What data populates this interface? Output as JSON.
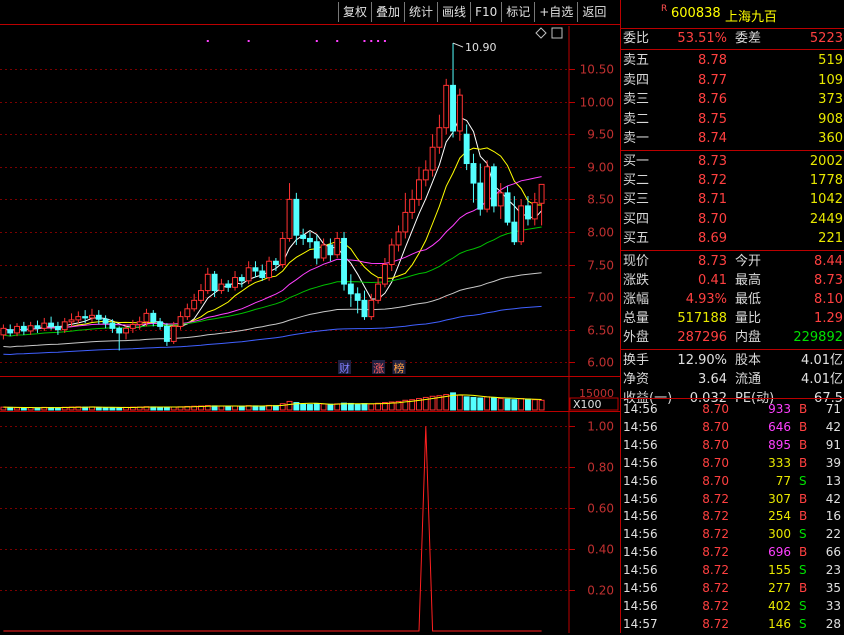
{
  "toolbar": [
    "复权",
    "叠加",
    "统计",
    "画线",
    "F10",
    "标记",
    "+自选",
    "返回"
  ],
  "stock": {
    "r_mark": "R",
    "code": "600838",
    "name": "上海九百"
  },
  "quote": {
    "wei_bi_label": "委比",
    "wei_bi": "53.51%",
    "wei_cha_label": "委差",
    "wei_cha": "5223",
    "asks": [
      {
        "label": "卖五",
        "price": "8.78",
        "vol": "519"
      },
      {
        "label": "卖四",
        "price": "8.77",
        "vol": "109"
      },
      {
        "label": "卖三",
        "price": "8.76",
        "vol": "373"
      },
      {
        "label": "卖二",
        "price": "8.75",
        "vol": "908"
      },
      {
        "label": "卖一",
        "price": "8.74",
        "vol": "360"
      }
    ],
    "bids": [
      {
        "label": "买一",
        "price": "8.73",
        "vol": "2002"
      },
      {
        "label": "买二",
        "price": "8.72",
        "vol": "1778"
      },
      {
        "label": "买三",
        "price": "8.71",
        "vol": "1042"
      },
      {
        "label": "买四",
        "price": "8.70",
        "vol": "2449"
      },
      {
        "label": "买五",
        "price": "8.69",
        "vol": "221"
      }
    ],
    "stats": [
      {
        "l1": "现价",
        "v1": "8.73",
        "c1": "red",
        "l2": "今开",
        "v2": "8.44",
        "c2": "red"
      },
      {
        "l1": "涨跌",
        "v1": "0.41",
        "c1": "red",
        "l2": "最高",
        "v2": "8.73",
        "c2": "red"
      },
      {
        "l1": "涨幅",
        "v1": "4.93%",
        "c1": "red",
        "l2": "最低",
        "v2": "8.10",
        "c2": "red"
      },
      {
        "l1": "总量",
        "v1": "517188",
        "c1": "yellow",
        "l2": "量比",
        "v2": "1.29",
        "c2": "red"
      },
      {
        "l1": "外盘",
        "v1": "287296",
        "c1": "red",
        "l2": "内盘",
        "v2": "229892",
        "c2": "green"
      }
    ],
    "info": [
      {
        "l1": "换手",
        "v1": "12.90%",
        "l2": "股本",
        "v2": "4.01亿"
      },
      {
        "l1": "净资",
        "v1": "3.64",
        "l2": "流通",
        "v2": "4.01亿"
      },
      {
        "l1": "收益(一)",
        "v1": "0.032",
        "l2": "PE(动)",
        "v2": "67.5"
      }
    ]
  },
  "ticks": [
    {
      "time": "14:56",
      "price": "8.70",
      "vol": "933",
      "dir": "B",
      "count": "71"
    },
    {
      "time": "14:56",
      "price": "8.70",
      "vol": "646",
      "dir": "B",
      "count": "42"
    },
    {
      "time": "14:56",
      "price": "8.70",
      "vol": "895",
      "dir": "B",
      "count": "91"
    },
    {
      "time": "14:56",
      "price": "8.70",
      "vol": "333",
      "dir": "B",
      "count": "39"
    },
    {
      "time": "14:56",
      "price": "8.70",
      "vol": "77",
      "dir": "S",
      "count": "13"
    },
    {
      "time": "14:56",
      "price": "8.72",
      "vol": "307",
      "dir": "B",
      "count": "42"
    },
    {
      "time": "14:56",
      "price": "8.72",
      "vol": "254",
      "dir": "B",
      "count": "16"
    },
    {
      "time": "14:56",
      "price": "8.72",
      "vol": "300",
      "dir": "S",
      "count": "22"
    },
    {
      "time": "14:56",
      "price": "8.72",
      "vol": "696",
      "dir": "B",
      "count": "66"
    },
    {
      "time": "14:56",
      "price": "8.72",
      "vol": "155",
      "dir": "S",
      "count": "23"
    },
    {
      "time": "14:56",
      "price": "8.72",
      "vol": "277",
      "dir": "B",
      "count": "35"
    },
    {
      "time": "14:56",
      "price": "8.72",
      "vol": "402",
      "dir": "S",
      "count": "33"
    },
    {
      "time": "14:57",
      "price": "8.72",
      "vol": "146",
      "dir": "S",
      "count": "28"
    }
  ],
  "chart_data": [
    {
      "type": "candlestick",
      "title": "",
      "ylim": [
        5.85,
        11.1
      ],
      "yticks": [
        "10.50",
        "10.00",
        "9.50",
        "9.00",
        "8.50",
        "8.00",
        "7.50",
        "7.00",
        "6.50",
        "6.00"
      ],
      "high_annotation": "10.90",
      "event_marks": [
        "财",
        "涨",
        "榜"
      ],
      "candles": [
        [
          6.42,
          6.52,
          6.35,
          6.58
        ],
        [
          6.5,
          6.45,
          6.4,
          6.58
        ],
        [
          6.45,
          6.55,
          6.4,
          6.6
        ],
        [
          6.55,
          6.48,
          6.42,
          6.62
        ],
        [
          6.48,
          6.56,
          6.42,
          6.62
        ],
        [
          6.56,
          6.52,
          6.45,
          6.64
        ],
        [
          6.52,
          6.6,
          6.48,
          6.68
        ],
        [
          6.6,
          6.55,
          6.5,
          6.7
        ],
        [
          6.55,
          6.5,
          6.42,
          6.62
        ],
        [
          6.5,
          6.62,
          6.45,
          6.68
        ],
        [
          6.62,
          6.65,
          6.55,
          6.75
        ],
        [
          6.65,
          6.7,
          6.6,
          6.78
        ],
        [
          6.7,
          6.68,
          6.6,
          6.8
        ],
        [
          6.68,
          6.72,
          6.62,
          6.82
        ],
        [
          6.72,
          6.66,
          6.58,
          6.8
        ],
        [
          6.66,
          6.6,
          6.52,
          6.72
        ],
        [
          6.6,
          6.52,
          6.45,
          6.66
        ],
        [
          6.52,
          6.45,
          6.18,
          6.55
        ],
        [
          6.45,
          6.52,
          6.35,
          6.58
        ],
        [
          6.52,
          6.58,
          6.45,
          6.65
        ],
        [
          6.58,
          6.62,
          6.5,
          6.7
        ],
        [
          6.62,
          6.75,
          6.55,
          6.82
        ],
        [
          6.75,
          6.62,
          6.55,
          6.8
        ],
        [
          6.62,
          6.55,
          6.5,
          6.68
        ],
        [
          6.55,
          6.32,
          6.25,
          6.6
        ],
        [
          6.32,
          6.55,
          6.28,
          6.62
        ],
        [
          6.55,
          6.7,
          6.5,
          6.78
        ],
        [
          6.7,
          6.82,
          6.65,
          6.9
        ],
        [
          6.82,
          6.95,
          6.78,
          7.05
        ],
        [
          6.95,
          7.1,
          6.9,
          7.2
        ],
        [
          7.1,
          7.35,
          7.05,
          7.45
        ],
        [
          7.35,
          7.1,
          7.0,
          7.4
        ],
        [
          7.1,
          7.2,
          7.05,
          7.28
        ],
        [
          7.2,
          7.15,
          7.08,
          7.26
        ],
        [
          7.15,
          7.3,
          7.1,
          7.4
        ],
        [
          7.3,
          7.25,
          7.15,
          7.35
        ],
        [
          7.25,
          7.45,
          7.2,
          7.55
        ],
        [
          7.45,
          7.4,
          7.3,
          7.55
        ],
        [
          7.4,
          7.3,
          7.25,
          7.5
        ],
        [
          7.3,
          7.55,
          7.25,
          7.62
        ],
        [
          7.55,
          7.5,
          7.4,
          7.6
        ],
        [
          7.5,
          7.9,
          7.45,
          8.0
        ],
        [
          7.9,
          8.5,
          7.85,
          8.75
        ],
        [
          8.5,
          7.95,
          7.8,
          8.6
        ],
        [
          7.95,
          7.9,
          7.8,
          8.05
        ],
        [
          7.9,
          7.85,
          7.75,
          8.0
        ],
        [
          7.85,
          7.6,
          7.5,
          7.95
        ],
        [
          7.6,
          7.8,
          7.55,
          7.9
        ],
        [
          7.8,
          7.65,
          7.55,
          7.9
        ],
        [
          7.65,
          7.9,
          7.6,
          8.0
        ],
        [
          7.9,
          7.2,
          7.1,
          8.0
        ],
        [
          7.2,
          7.05,
          6.85,
          7.35
        ],
        [
          7.05,
          6.95,
          6.75,
          7.15
        ],
        [
          6.95,
          6.7,
          6.65,
          7.1
        ],
        [
          6.7,
          6.95,
          6.65,
          7.05
        ],
        [
          6.95,
          7.2,
          6.9,
          7.3
        ],
        [
          7.2,
          7.5,
          7.15,
          7.6
        ],
        [
          7.5,
          7.8,
          7.4,
          7.9
        ],
        [
          7.8,
          8.0,
          7.7,
          8.1
        ],
        [
          8.0,
          8.3,
          7.9,
          8.6
        ],
        [
          8.3,
          8.5,
          8.2,
          8.65
        ],
        [
          8.5,
          8.8,
          8.4,
          9.0
        ],
        [
          8.8,
          8.95,
          8.7,
          9.1
        ],
        [
          8.95,
          9.3,
          8.85,
          9.5
        ],
        [
          9.3,
          9.6,
          9.2,
          9.8
        ],
        [
          9.6,
          10.25,
          9.5,
          10.35
        ],
        [
          10.25,
          9.55,
          9.45,
          10.9
        ],
        [
          9.55,
          10.1,
          9.4,
          10.2
        ],
        [
          9.5,
          9.05,
          8.95,
          9.65
        ],
        [
          9.05,
          8.75,
          8.45,
          9.2
        ],
        [
          8.75,
          8.35,
          8.25,
          9.05
        ],
        [
          8.35,
          9.0,
          8.3,
          9.1
        ],
        [
          9.0,
          8.4,
          8.3,
          9.05
        ],
        [
          8.4,
          8.6,
          8.2,
          8.75
        ],
        [
          8.6,
          8.15,
          8.1,
          8.7
        ],
        [
          8.15,
          7.85,
          7.8,
          8.55
        ],
        [
          7.85,
          8.4,
          7.8,
          8.5
        ],
        [
          8.4,
          8.2,
          8.1,
          8.55
        ],
        [
          8.2,
          8.45,
          8.1,
          8.6
        ],
        [
          8.44,
          8.73,
          8.1,
          8.73
        ]
      ],
      "ma": [
        {
          "name": "MA5",
          "color": "#ffffff"
        },
        {
          "name": "MA10",
          "color": "#ffff00"
        },
        {
          "name": "MA20",
          "color": "#ff40ff"
        },
        {
          "name": "MA60",
          "color": "#00c000"
        },
        {
          "name": "MA120",
          "color": "#c8c8c8"
        },
        {
          "name": "MA250",
          "color": "#4060ff"
        }
      ]
    },
    {
      "type": "bar",
      "title": "",
      "ytick": "15000",
      "unit_label": "X100",
      "values": [
        50,
        45,
        40,
        38,
        42,
        40,
        46,
        44,
        40,
        48,
        52,
        55,
        50,
        54,
        46,
        42,
        40,
        44,
        46,
        50,
        52,
        58,
        54,
        50,
        48,
        52,
        56,
        62,
        66,
        70,
        78,
        72,
        68,
        66,
        70,
        68,
        76,
        72,
        68,
        80,
        76,
        110,
        150,
        130,
        100,
        95,
        110,
        105,
        100,
        108,
        120,
        115,
        100,
        112,
        104,
        118,
        130,
        140,
        150,
        170,
        180,
        200,
        220,
        240,
        250,
        270,
        300,
        260,
        230,
        220,
        210,
        230,
        220,
        200,
        190,
        180,
        200,
        190,
        180,
        170
      ]
    },
    {
      "type": "line",
      "title": "",
      "ylim": [
        0,
        1.06
      ],
      "yticks": [
        "1.00",
        "0.80",
        "0.60",
        "0.40",
        "0.20"
      ],
      "values": [
        0,
        0,
        0,
        0,
        0,
        0,
        0,
        0,
        0,
        0,
        0,
        0,
        0,
        0,
        0,
        0,
        0,
        0,
        0,
        0,
        0,
        0,
        0,
        0,
        0,
        0,
        0,
        0,
        0,
        0,
        0,
        0,
        0,
        0,
        0,
        0,
        0,
        0,
        0,
        0,
        0,
        0,
        0,
        0,
        0,
        0,
        0,
        0,
        0,
        0,
        0,
        0,
        0,
        0,
        0,
        0,
        0,
        0,
        0,
        0,
        0,
        0,
        1,
        0,
        0,
        0,
        0,
        0,
        0,
        0,
        0,
        0,
        0,
        0,
        0,
        0,
        0,
        0,
        0,
        0
      ]
    }
  ]
}
